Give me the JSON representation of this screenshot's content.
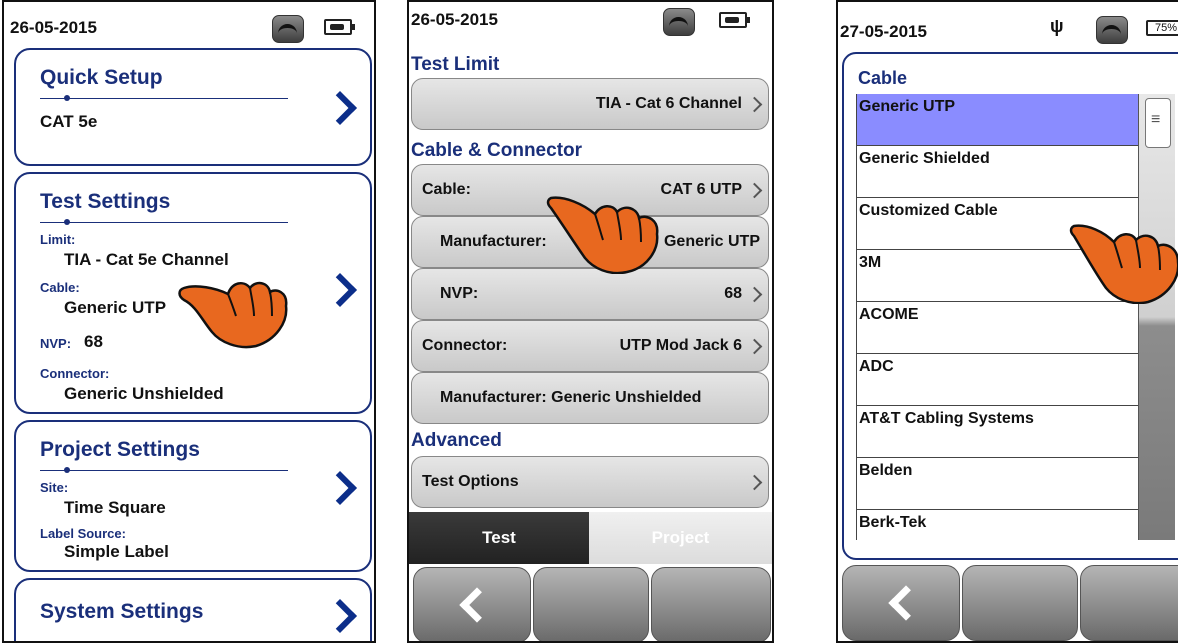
{
  "screen1": {
    "date": "26-05-2015",
    "quick_setup": {
      "title": "Quick Setup",
      "value": "CAT 5e"
    },
    "test_settings": {
      "title": "Test Settings",
      "limit_label": "Limit:",
      "limit_value": "TIA - Cat 5e Channel",
      "cable_label": "Cable:",
      "cable_value": "Generic UTP",
      "nvp_label": "NVP:",
      "nvp_value": "68",
      "connector_label": "Connector:",
      "connector_value": "Generic Unshielded"
    },
    "project_settings": {
      "title": "Project Settings",
      "site_label": "Site:",
      "site_value": "Time Square",
      "label_source_label": "Label Source:",
      "label_source_value": "Simple Label"
    },
    "system_settings": {
      "title": "System Settings"
    }
  },
  "screen2": {
    "date": "26-05-2015",
    "test_limit_header": "Test Limit",
    "test_limit_value": "TIA - Cat 6 Channel",
    "cable_connector_header": "Cable & Connector",
    "cable_label": "Cable:",
    "cable_value": "CAT 6 UTP",
    "manufacturer1_label": "Manufacturer:",
    "manufacturer1_value": "Generic UTP",
    "nvp_label": "NVP:",
    "nvp_value": "68",
    "connector_label": "Connector:",
    "connector_value": "UTP Mod Jack 6",
    "manufacturer2": "Manufacturer: Generic Unshielded",
    "advanced_header": "Advanced",
    "test_options": "Test Options",
    "tabs": [
      "Test",
      "Project"
    ]
  },
  "screen3": {
    "date": "27-05-2015",
    "battery": "75%",
    "header": "Cable",
    "items": [
      "Generic UTP",
      "Generic Shielded",
      "Customized Cable",
      "3M",
      "ACOME",
      "ADC",
      "AT&T Cabling Systems",
      "Belden",
      "Berk-Tek"
    ]
  },
  "colors": {
    "accent": "#1a2f7a",
    "chevron": "#0c2e8a",
    "selection": "#8a8cff",
    "hand": "#e8681f"
  }
}
